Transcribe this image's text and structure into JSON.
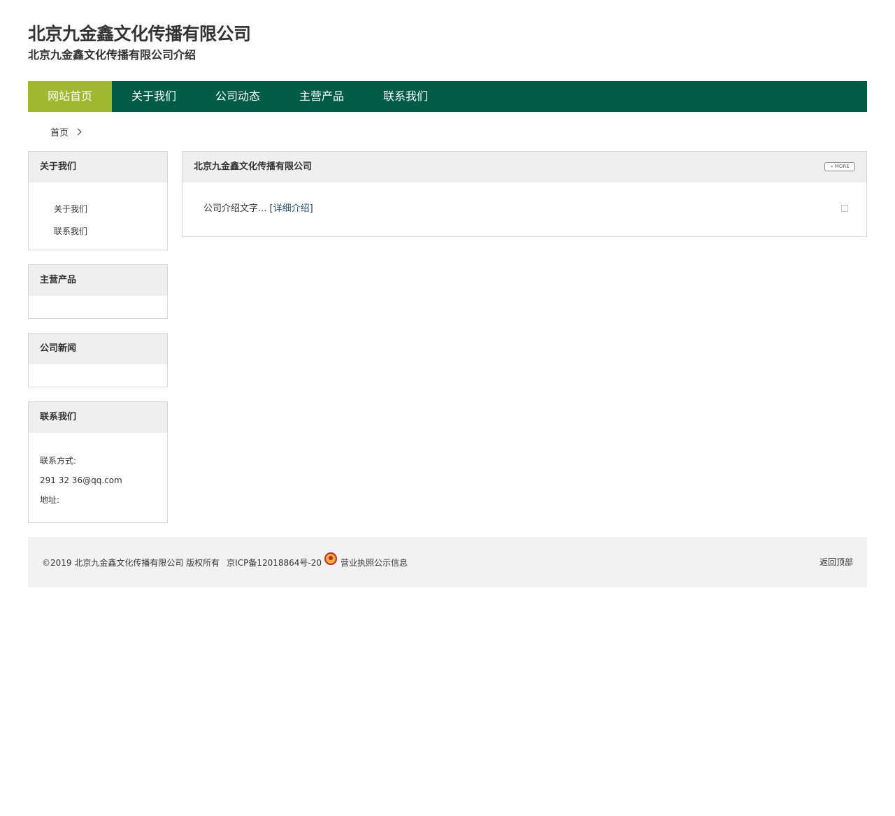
{
  "header": {
    "title": "北京九金鑫文化传播有限公司",
    "subtitle": "北京九金鑫文化传播有限公司介绍"
  },
  "nav": {
    "items": [
      {
        "label": "网站首页",
        "active": true
      },
      {
        "label": "关于我们"
      },
      {
        "label": "公司动态"
      },
      {
        "label": "主营产品"
      },
      {
        "label": "联系我们"
      }
    ]
  },
  "breadcrumb": {
    "home": "首页"
  },
  "sidebar": {
    "about": {
      "title": "关于我们",
      "links": [
        "关于我们",
        "联系我们"
      ]
    },
    "products": {
      "title": "主营产品"
    },
    "news": {
      "title": "公司新闻"
    },
    "contact": {
      "title": "联系我们",
      "method_label": "联系方式:",
      "email": "291 32 36@qq.com",
      "address_label": "地址:"
    }
  },
  "main": {
    "title": "北京九金鑫文化传播有限公司",
    "more_label": "» MORE",
    "intro_text": "公司介绍文字...",
    "detail_link": "详细介绍"
  },
  "footer": {
    "copyright": "©2019 北京九金鑫文化传播有限公司 版权所有",
    "icp": "京ICP备12018864号-20",
    "license": "营业执照公示信息",
    "back_top": "返回顶部"
  },
  "colors": {
    "nav_bg": "#005c47",
    "nav_active": "#9fb830",
    "link": "#1f4f7a"
  }
}
